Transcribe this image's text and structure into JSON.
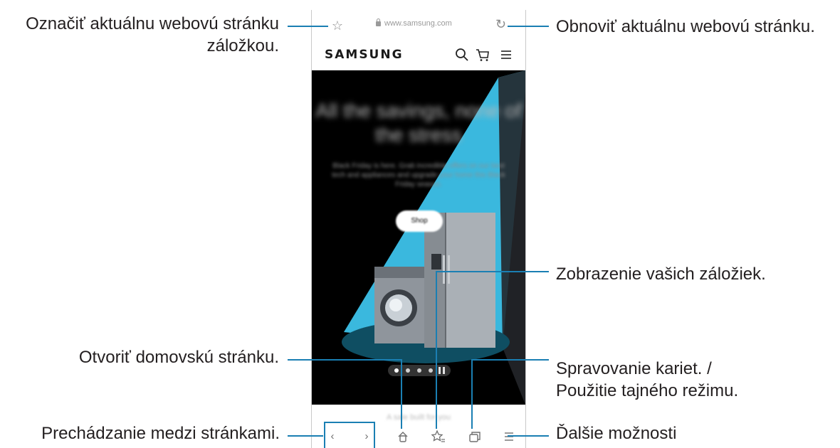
{
  "callouts": {
    "bookmark_page": "Označiť aktuálnu webovú stránku záložkou.",
    "refresh_page": "Obnoviť aktuálnu webovú stránku.",
    "view_bookmarks": "Zobrazenie vašich záložiek.",
    "open_home": "Otvoriť domovskú stránku.",
    "manage_tabs_line1": "Spravovanie kariet. /",
    "manage_tabs_line2": "Použitie tajného režimu.",
    "navigate_pages": "Prechádzanie medzi stránkami.",
    "more_options": "Ďalšie možnosti"
  },
  "browser": {
    "url": "www.samsung.com",
    "logo": "SAMSUNG",
    "hero_title": "All the savings, none of the stress",
    "hero_subtitle": "Black Friday is here. Grab incredible offers on our best tech and appliances and upgrade your home this Black Friday season.",
    "shop_button": "Shop",
    "below_text": "A sale built for you"
  },
  "colors": {
    "callout_line": "#1a7fb3",
    "hero_light": "#3ab8de"
  }
}
